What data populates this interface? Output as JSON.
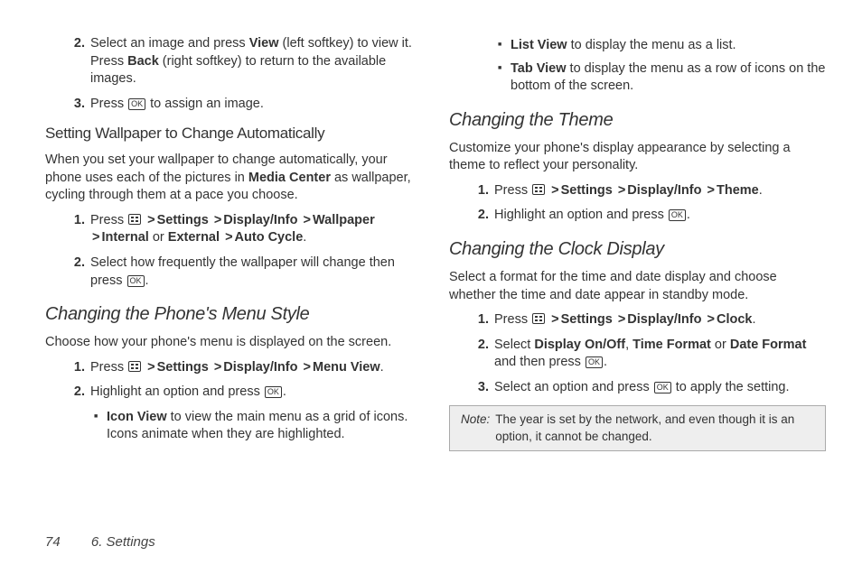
{
  "col1": {
    "list1": {
      "item2": {
        "pre": "Select an image and press ",
        "b1": "View",
        "mid": " (left softkey) to view it. Press ",
        "b2": "Back",
        "post": " (right softkey) to return to the available images."
      },
      "item3": {
        "pre": "Press ",
        "ok": "OK",
        "post": " to assign an image."
      }
    },
    "h3": "Setting Wallpaper to Change Automatically",
    "p1": {
      "pre": "When you set your wallpaper to change automatically, your phone uses each of the pictures in ",
      "b": "Media Center",
      "post": " as wallpaper, cycling through them at a pace you choose."
    },
    "list2": {
      "item1": {
        "press": "Press ",
        "settings": "Settings",
        "display": "Display/Info",
        "wallpaper": "Wallpaper",
        "internal": "Internal",
        "or": " or ",
        "external": "External",
        "auto": "Auto Cycle",
        "dot": "."
      },
      "item2": {
        "pre": "Select how frequently the wallpaper will change then press ",
        "ok": "OK",
        "post": "."
      }
    },
    "h2": "Changing the Phone's Menu Style",
    "p2": "Choose how your phone's menu is displayed on the screen.",
    "list3": {
      "item1": {
        "press": "Press ",
        "settings": "Settings",
        "display": "Display/Info",
        "menuview": "Menu View",
        "dot": "."
      },
      "item2": {
        "pre": "Highlight an option and press ",
        "ok": "OK",
        "post": "."
      }
    },
    "sub1": {
      "a": {
        "b": "Icon View",
        "post": " to view the main menu as a grid of icons. Icons animate when they are highlighted."
      }
    }
  },
  "col2": {
    "sub1": {
      "b": {
        "b": "List View",
        "post": " to display the menu as a list."
      },
      "c": {
        "b": "Tab View",
        "post": " to display the menu as a row of icons on the bottom of the screen."
      }
    },
    "h2a": "Changing the Theme",
    "p1": "Customize your phone's display appearance by selecting a theme to reflect your personality.",
    "list1": {
      "item1": {
        "press": "Press ",
        "settings": "Settings",
        "display": "Display/Info",
        "theme": "Theme",
        "dot": "."
      },
      "item2": {
        "pre": "Highlight an option and press ",
        "ok": "OK",
        "post": "."
      }
    },
    "h2b": "Changing the Clock Display",
    "p2": "Select a format for the time and date display and choose whether the time and date appear in standby mode.",
    "list2": {
      "item1": {
        "press": "Press ",
        "settings": "Settings",
        "display": "Display/Info",
        "clock": "Clock",
        "dot": "."
      },
      "item2": {
        "pre": "Select ",
        "b1": "Display On/Off",
        "c1": ", ",
        "b2": "Time Format",
        "c2": " or ",
        "b3": "Date Format",
        "mid": " and then press ",
        "ok": "OK",
        "post": "."
      },
      "item3": {
        "pre": "Select an option and press ",
        "ok": "OK",
        "post": " to apply the setting."
      }
    },
    "note": {
      "label": "Note:",
      "text": "The year is set by the network, and even though it is an option, it cannot be changed."
    }
  },
  "footer": {
    "page": "74",
    "section": "6. Settings"
  },
  "glyph": {
    "gt": ">"
  }
}
